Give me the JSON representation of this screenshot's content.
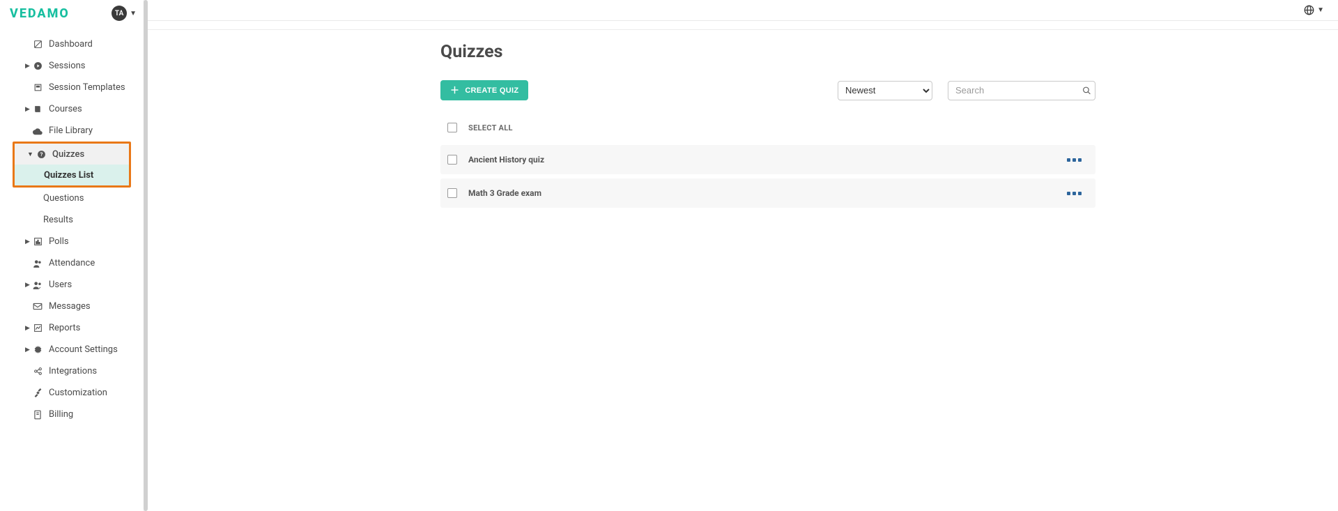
{
  "brand": "VEDAMO",
  "user_initials": "TA",
  "page_title": "Quizzes",
  "create_button": "CREATE QUIZ",
  "sort_selected": "Newest",
  "search_placeholder": "Search",
  "select_all_label": "SELECT ALL",
  "sidebar": {
    "dashboard": "Dashboard",
    "sessions": "Sessions",
    "session_templates": "Session Templates",
    "courses": "Courses",
    "file_library": "File Library",
    "quizzes": "Quizzes",
    "quizzes_list": "Quizzes List",
    "questions": "Questions",
    "results": "Results",
    "polls": "Polls",
    "attendance": "Attendance",
    "users": "Users",
    "messages": "Messages",
    "reports": "Reports",
    "account_settings": "Account Settings",
    "integrations": "Integrations",
    "customization": "Customization",
    "billing": "Billing"
  },
  "quizzes": [
    {
      "title": "Ancient History quiz"
    },
    {
      "title": "Math 3 Grade exam"
    }
  ]
}
